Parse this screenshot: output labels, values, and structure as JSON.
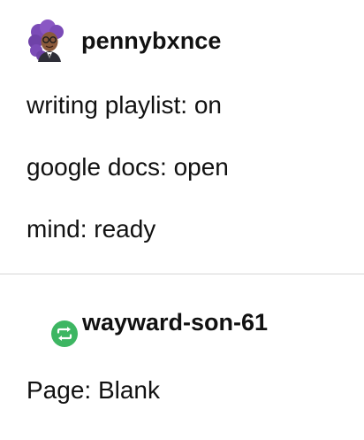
{
  "colors": {
    "text": "#111111",
    "divider": "#d6d6d6",
    "reblog_green": "#3db662",
    "avatar_hair": "#7b4bb7",
    "avatar_skin": "#8a5a3c",
    "avatar_suit": "#2e2e38"
  },
  "original_post": {
    "avatar_icon": "avatar-icon",
    "username": "pennybxnce",
    "lines": [
      "writing playlist: on",
      "google docs: open",
      "mind: ready"
    ]
  },
  "reblog": {
    "icon": "reblog-icon",
    "username": "wayward-son-61",
    "lines": [
      "Page: Blank"
    ]
  }
}
